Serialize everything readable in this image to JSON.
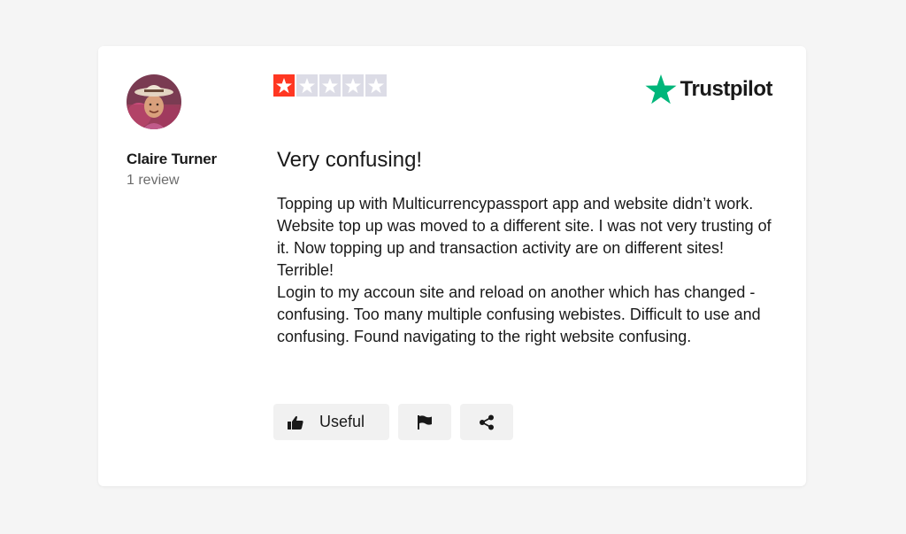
{
  "reviewer": {
    "name": "Claire Turner",
    "review_count": "1 review"
  },
  "rating": {
    "stars": 1,
    "max": 5,
    "filled_color": "#ff3722",
    "empty_color": "#dcdce6"
  },
  "brand": {
    "name": "Trustpilot",
    "star_color": "#00b67a"
  },
  "review": {
    "title": "Very confusing!",
    "paragraphs": [
      "Topping up with Multicurrencypassport app and website didn’t work. Website top up was moved to a different site. I was not very trusting of it. Now topping up and transaction activity are on different sites! Terrible!",
      "Login to my accoun site and reload on another which has changed - confusing. Too many multiple confusing webistes. Difficult to use and confusing. Found navigating to the right website confusing."
    ]
  },
  "actions": {
    "useful_label": "Useful",
    "useful_icon": "thumbs-up-icon",
    "flag_icon": "flag-icon",
    "share_icon": "share-icon"
  }
}
